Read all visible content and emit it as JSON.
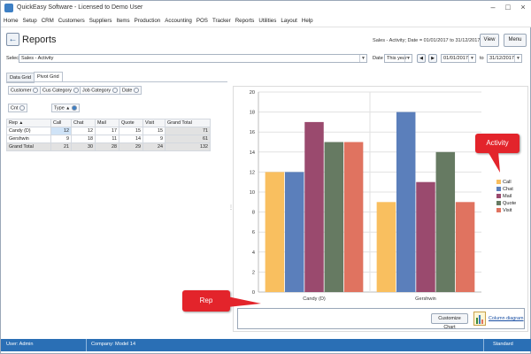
{
  "window": {
    "title": "QuickEasy Software - Licensed to Demo User"
  },
  "menu": [
    "Home",
    "Setup",
    "CRM",
    "Customers",
    "Suppliers",
    "Items",
    "Production",
    "Accounting",
    "POS",
    "Tracker",
    "Reports",
    "Utilities",
    "Layout",
    "Help"
  ],
  "header": {
    "title": "Reports",
    "subtitle": "Sales - Activity; Date = 01/01/2017 to 31/12/2017",
    "view_label": "View",
    "menu_label": "Menu"
  },
  "selector": {
    "label": "Select",
    "value": "Sales - Activity",
    "date_label": "Date",
    "period": "This year",
    "from_date": "01/01/2017",
    "to_label": "to",
    "to_date": "31/12/2017"
  },
  "tabs": [
    "Data Grid",
    "Pivot Grid"
  ],
  "filter_fields": [
    "Customer",
    "Cus Category",
    "Job Category",
    "Date"
  ],
  "data_fields": [
    "Cnt"
  ],
  "column_fields": [
    "Type"
  ],
  "row_field": "Rep",
  "grid": {
    "columns": [
      "Call",
      "Chat",
      "Mail",
      "Quote",
      "Visit",
      "Grand Total"
    ],
    "rows": [
      {
        "label": "Candy (D)",
        "values": [
          "12",
          "12",
          "17",
          "15",
          "15",
          "71"
        ]
      },
      {
        "label": "Gershwin",
        "values": [
          "9",
          "18",
          "11",
          "14",
          "9",
          "61"
        ]
      },
      {
        "label": "Grand Total",
        "values": [
          "21",
          "30",
          "28",
          "29",
          "24",
          "132"
        ]
      }
    ]
  },
  "chart_data": {
    "type": "bar",
    "categories": [
      "Candy (D)",
      "Gershwin"
    ],
    "series": [
      {
        "name": "Call",
        "values": [
          12,
          9
        ],
        "color": "#f9bf5f"
      },
      {
        "name": "Chat",
        "values": [
          12,
          18
        ],
        "color": "#5b7fbb"
      },
      {
        "name": "Mail",
        "values": [
          17,
          11
        ],
        "color": "#9a4a6e"
      },
      {
        "name": "Quote",
        "values": [
          15,
          14
        ],
        "color": "#667a62"
      },
      {
        "name": "Visit",
        "values": [
          15,
          9
        ],
        "color": "#e07360"
      }
    ],
    "ylim": [
      0,
      20
    ],
    "yticks": [
      "0",
      "2",
      "4",
      "6",
      "8",
      "10",
      "12",
      "14",
      "16",
      "18",
      "20"
    ],
    "grid": true,
    "legend": "right"
  },
  "callouts": {
    "activity": "Activity",
    "rep": "Rep"
  },
  "chart_footer": {
    "customize_label": "Customize Chart",
    "diagram_label": "Column diagram"
  },
  "status": {
    "user": "User: Admin",
    "company": "Company: Model 14",
    "mode": "Standard"
  },
  "colors": {
    "statusbar": "#2a6fb5",
    "callout": "#e3242b",
    "total_cell": "#e2e2e2"
  }
}
